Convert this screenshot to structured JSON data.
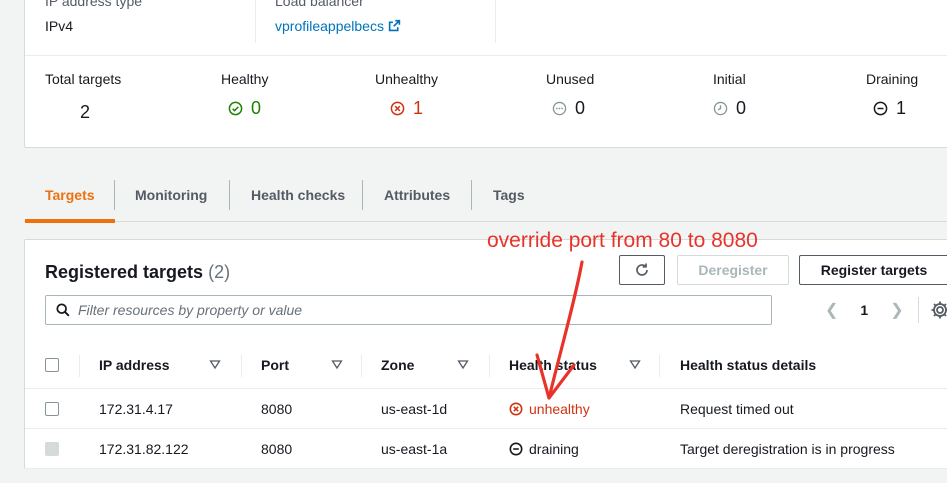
{
  "details": {
    "ip_type_label": "IP address type",
    "ip_type_value": "IPv4",
    "lb_label": "Load balancer",
    "lb_value": "vprofileappelbecs"
  },
  "stats": [
    {
      "label": "Total targets",
      "value": "2",
      "color": "#16191f"
    },
    {
      "label": "Healthy",
      "value": "0",
      "icon": "check-circle-icon",
      "color": "#1d8102"
    },
    {
      "label": "Unhealthy",
      "value": "1",
      "icon": "x-circle-icon",
      "color": "#d13212"
    },
    {
      "label": "Unused",
      "value": "0",
      "icon": "dots-circle-icon",
      "color": "#879596"
    },
    {
      "label": "Initial",
      "value": "0",
      "icon": "clock-icon",
      "color": "#879596"
    },
    {
      "label": "Draining",
      "value": "1",
      "icon": "minus-circle-icon",
      "color": "#16191f"
    }
  ],
  "tabs": [
    {
      "label": "Targets",
      "active": true
    },
    {
      "label": "Monitoring"
    },
    {
      "label": "Health checks"
    },
    {
      "label": "Attributes"
    },
    {
      "label": "Tags"
    }
  ],
  "panel": {
    "title": "Registered targets",
    "count": "(2)",
    "refresh_icon": "refresh-icon",
    "deregister_label": "Deregister",
    "register_label": "Register targets",
    "search_placeholder": "Filter resources by property or value",
    "page_number": "1"
  },
  "table": {
    "columns": [
      "IP address",
      "Port",
      "Zone",
      "Health status",
      "Health status details"
    ],
    "rows": [
      {
        "ip": "172.31.4.17",
        "port": "8080",
        "zone": "us-east-1d",
        "status": "unhealthy",
        "status_icon": "x-circle-icon",
        "details": "Request timed out"
      },
      {
        "ip": "172.31.82.122",
        "port": "8080",
        "zone": "us-east-1a",
        "status": "draining",
        "status_icon": "minus-circle-icon",
        "details": "Target deregistration is in progress"
      }
    ]
  },
  "annotation": {
    "text": "override port from 80 to 8080",
    "color": "#e8332a"
  },
  "colors": {
    "accent": "#ec7211",
    "link": "#0073bb",
    "healthy": "#1d8102",
    "unhealthy": "#d13212"
  }
}
